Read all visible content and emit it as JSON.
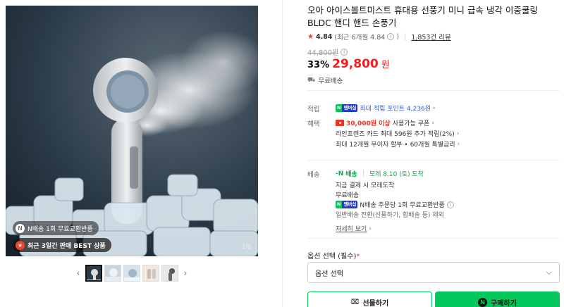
{
  "gallery": {
    "badge_1": "N배송 1회 무료교환반품",
    "badge_2": "최근 3일간 판매 BEST 상품",
    "page_count": "1/6",
    "prev_arrow": "‹",
    "next_arrow": "›"
  },
  "product": {
    "title": "오아 아이스볼트미스트 휴대용 선풍기 미니 급속 냉각 이중쿨링 BLDC 핸디 핸드 손풍기",
    "rating": "4.84",
    "rating_recent": "(최근 6개월 4.84",
    "review_count": "1,853건 리뷰",
    "original_price": "44,800원",
    "discount": "33%",
    "price": "29,800",
    "price_unit": "원",
    "shipping": "무료배송"
  },
  "benefits": {
    "point_label": "적립",
    "point_text": "최대 적립 포인트 4,236원",
    "benefit_label": "혜택",
    "coupon_strong": "30,000원 이상",
    "coupon_rest": "사용가능 쿠폰",
    "card_text": "라인프렌즈 카드 최대 596원 추가 적립(2%)",
    "installment_text": "최대 12개월 무이자 할부 • 60개월 특별금리"
  },
  "delivery": {
    "label": "배송",
    "badge": "배송",
    "date": "모레 8.10 (토) 도착",
    "line_1": "지금 결제 시 모레도착",
    "line_2": "무료배송",
    "line_3": "N배송 주문당 1회 무료교환반품",
    "line_4": "일반배송 전환(선물하기, 합배송 등) 제외",
    "detail_link": "자세히 보기"
  },
  "option": {
    "label": "옵션 선택 (필수)",
    "required_mark": "*",
    "select_value": "옵션 선택"
  },
  "actions": {
    "gift": "선물하기",
    "buy": "구매하기"
  },
  "npay": {
    "n": "N",
    "m": "멤버십"
  }
}
